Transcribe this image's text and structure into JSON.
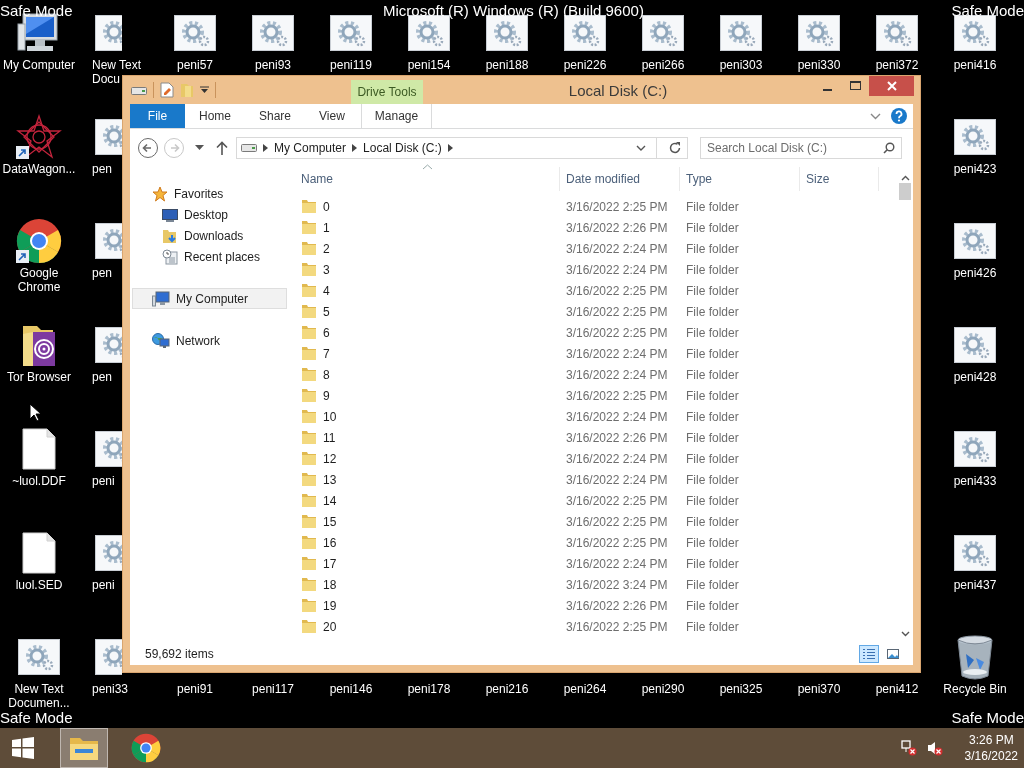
{
  "overlay_texts": {
    "top_left": "Safe Mode",
    "top_center": "Microsoft (R) Windows (R) (Build 9600)",
    "top_right": "Safe Mode",
    "bottom_left": "Safe Mode",
    "bottom_right": "Safe Mode"
  },
  "desktop_icons": [
    {
      "label": "My Computer",
      "kind": "computer",
      "clipped": false
    },
    {
      "label": "New Text Docu",
      "kind": "gear",
      "clipped": true
    },
    {
      "label": "peni57",
      "kind": "gear",
      "clipped": false
    },
    {
      "label": "peni93",
      "kind": "gear",
      "clipped": false
    },
    {
      "label": "peni119",
      "kind": "gear",
      "clipped": false
    },
    {
      "label": "peni154",
      "kind": "gear",
      "clipped": false
    },
    {
      "label": "peni188",
      "kind": "gear",
      "clipped": false
    },
    {
      "label": "peni226",
      "kind": "gear",
      "clipped": false
    },
    {
      "label": "peni266",
      "kind": "gear",
      "clipped": false
    },
    {
      "label": "peni303",
      "kind": "gear",
      "clipped": false
    },
    {
      "label": "peni330",
      "kind": "gear",
      "clipped": false
    },
    {
      "label": "peni372",
      "kind": "gear",
      "clipped": false
    },
    {
      "label": "peni416",
      "kind": "gear",
      "clipped": false
    },
    {
      "label": "DataWagon...",
      "kind": "star",
      "clipped": false
    },
    {
      "label": "pen",
      "kind": "gear",
      "clipped": true
    },
    {
      "label": "peni423",
      "kind": "gear",
      "clipped": false
    },
    {
      "label": "Google Chrome",
      "kind": "chrome",
      "clipped": false
    },
    {
      "label": "pen",
      "kind": "gear",
      "clipped": true
    },
    {
      "label": "peni426",
      "kind": "gear",
      "clipped": false
    },
    {
      "label": "Tor Browser",
      "kind": "tor",
      "clipped": false
    },
    {
      "label": "pen",
      "kind": "gear",
      "clipped": true
    },
    {
      "label": "peni428",
      "kind": "gear",
      "clipped": false
    },
    {
      "label": "~luol.DDF",
      "kind": "file",
      "clipped": false
    },
    {
      "label": "peni",
      "kind": "gear",
      "clipped": true
    },
    {
      "label": "peni433",
      "kind": "gear",
      "clipped": false
    },
    {
      "label": "luol.SED",
      "kind": "file",
      "clipped": false
    },
    {
      "label": "peni",
      "kind": "gear",
      "clipped": true
    },
    {
      "label": "peni437",
      "kind": "gear",
      "clipped": false
    },
    {
      "label": "New Text Documen...",
      "kind": "gear",
      "clipped": false
    },
    {
      "label": "peni33",
      "kind": "gear",
      "clipped": true
    },
    {
      "label": "peni91",
      "kind": "covered",
      "clipped": false
    },
    {
      "label": "peni117",
      "kind": "covered",
      "clipped": false
    },
    {
      "label": "peni146",
      "kind": "covered",
      "clipped": false
    },
    {
      "label": "peni178",
      "kind": "covered",
      "clipped": false
    },
    {
      "label": "peni216",
      "kind": "covered",
      "clipped": false
    },
    {
      "label": "peni264",
      "kind": "covered",
      "clipped": false
    },
    {
      "label": "peni290",
      "kind": "covered",
      "clipped": false
    },
    {
      "label": "peni325",
      "kind": "covered",
      "clipped": false
    },
    {
      "label": "peni370",
      "kind": "covered",
      "clipped": false
    },
    {
      "label": "peni412",
      "kind": "covered",
      "clipped": false
    },
    {
      "label": "Recycle Bin",
      "kind": "recycle",
      "clipped": false
    }
  ],
  "explorer": {
    "title": "Local Disk (C:)",
    "context_tab_group": "Drive Tools",
    "ribbon_tabs": [
      {
        "label": "File",
        "kind": "file"
      },
      {
        "label": "Home",
        "kind": "plain"
      },
      {
        "label": "Share",
        "kind": "plain"
      },
      {
        "label": "View",
        "kind": "plain"
      },
      {
        "label": "Manage",
        "kind": "context"
      }
    ],
    "nav_buttons": [
      {
        "kind": "back",
        "disabled": false
      },
      {
        "kind": "forward",
        "disabled": true
      }
    ],
    "address": {
      "crumbs": [
        "My Computer",
        "Local Disk (C:)"
      ]
    },
    "search": {
      "placeholder": "Search Local Disk (C:)"
    },
    "nav_pane": [
      {
        "label": "Favorites",
        "kind": "star",
        "selected": false,
        "children": [
          {
            "label": "Desktop",
            "kind": "desktop",
            "selected": false
          },
          {
            "label": "Downloads",
            "kind": "downloads",
            "selected": false
          },
          {
            "label": "Recent places",
            "kind": "recent",
            "selected": false
          }
        ]
      },
      {
        "label": "My Computer",
        "kind": "computer",
        "selected": true
      },
      {
        "label": "Network",
        "kind": "network",
        "selected": false
      }
    ],
    "columns": [
      {
        "label": "Name",
        "sorted": true
      },
      {
        "label": "Date modified",
        "sorted": false
      },
      {
        "label": "Type",
        "sorted": false
      },
      {
        "label": "Size",
        "sorted": false
      }
    ],
    "rows": [
      {
        "name": "0",
        "date": "3/16/2022 2:25 PM",
        "type": "File folder"
      },
      {
        "name": "1",
        "date": "3/16/2022 2:26 PM",
        "type": "File folder"
      },
      {
        "name": "2",
        "date": "3/16/2022 2:24 PM",
        "type": "File folder"
      },
      {
        "name": "3",
        "date": "3/16/2022 2:24 PM",
        "type": "File folder"
      },
      {
        "name": "4",
        "date": "3/16/2022 2:25 PM",
        "type": "File folder"
      },
      {
        "name": "5",
        "date": "3/16/2022 2:25 PM",
        "type": "File folder"
      },
      {
        "name": "6",
        "date": "3/16/2022 2:25 PM",
        "type": "File folder"
      },
      {
        "name": "7",
        "date": "3/16/2022 2:24 PM",
        "type": "File folder"
      },
      {
        "name": "8",
        "date": "3/16/2022 2:24 PM",
        "type": "File folder"
      },
      {
        "name": "9",
        "date": "3/16/2022 2:25 PM",
        "type": "File folder"
      },
      {
        "name": "10",
        "date": "3/16/2022 2:24 PM",
        "type": "File folder"
      },
      {
        "name": "11",
        "date": "3/16/2022 2:26 PM",
        "type": "File folder"
      },
      {
        "name": "12",
        "date": "3/16/2022 2:24 PM",
        "type": "File folder"
      },
      {
        "name": "13",
        "date": "3/16/2022 2:24 PM",
        "type": "File folder"
      },
      {
        "name": "14",
        "date": "3/16/2022 2:25 PM",
        "type": "File folder"
      },
      {
        "name": "15",
        "date": "3/16/2022 2:25 PM",
        "type": "File folder"
      },
      {
        "name": "16",
        "date": "3/16/2022 2:25 PM",
        "type": "File folder"
      },
      {
        "name": "17",
        "date": "3/16/2022 2:24 PM",
        "type": "File folder"
      },
      {
        "name": "18",
        "date": "3/16/2022 3:24 PM",
        "type": "File folder"
      },
      {
        "name": "19",
        "date": "3/16/2022 2:26 PM",
        "type": "File folder"
      },
      {
        "name": "20",
        "date": "3/16/2022 2:25 PM",
        "type": "File folder"
      }
    ],
    "status_bar": {
      "item_count": "59,692 items",
      "views": [
        {
          "kind": "details",
          "selected": true
        },
        {
          "kind": "large-icons",
          "selected": false
        }
      ]
    }
  },
  "taskbar": {
    "buttons": [
      {
        "kind": "start",
        "active": false
      },
      {
        "kind": "explorer",
        "active": true
      },
      {
        "kind": "chrome",
        "active": false
      }
    ],
    "tray_icons": [
      {
        "kind": "network-error"
      },
      {
        "kind": "speaker-muted"
      }
    ],
    "time": "3:26 PM",
    "date": "3/16/2022"
  }
}
